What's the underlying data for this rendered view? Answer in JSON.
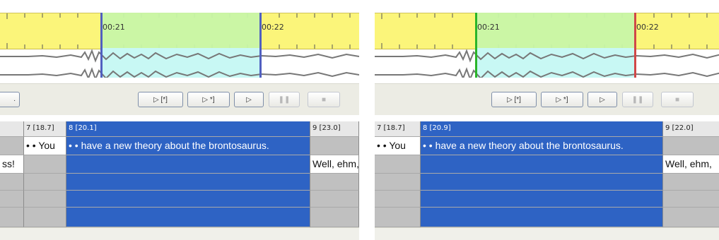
{
  "panels": {
    "left": {
      "ruler": {
        "t1": "00:21",
        "t2": "00:22"
      },
      "toolbar": {
        "btn_play_sel_start": "▷ [*]",
        "btn_play_sel_end": "▷ *]",
        "btn_play": "▷",
        "btn_pause": "❚❚",
        "btn_stop": "■"
      },
      "grid": {
        "h7": "7 [18.7]",
        "h8": "8 [20.1]",
        "h9": "9 [23.0]",
        "t7": "• • You",
        "t8": "• • have a new theory about the brontosaurus.",
        "t9": "Well, ehm,",
        "t_left": "ss!"
      }
    },
    "right": {
      "ruler": {
        "t1": "00:21",
        "t2": "00:22"
      },
      "toolbar": {
        "btn_play_sel_start": "▷ [*]",
        "btn_play_sel_end": "▷ *]",
        "btn_play": "▷",
        "btn_pause": "❚❚",
        "btn_stop": "■"
      },
      "grid": {
        "h7": "7 [18.7]",
        "h8": "8 [20.9]",
        "h9": "9 [22.0]",
        "t7": "• • You",
        "t8": "• • have a new theory about the brontosaurus.",
        "t9": "Well, ehm,"
      }
    }
  },
  "colors": {
    "ruler": "#fbf57a",
    "selection_ruler": "#c8f5a8",
    "selection_wave": "#c8f8f4",
    "grid_selected": "#2e63c4",
    "cursor_left_start": "#5060c0",
    "cursor_left_end": "#5060c0",
    "cursor_right_start": "#2ab52a",
    "cursor_right_end": "#d04848"
  }
}
